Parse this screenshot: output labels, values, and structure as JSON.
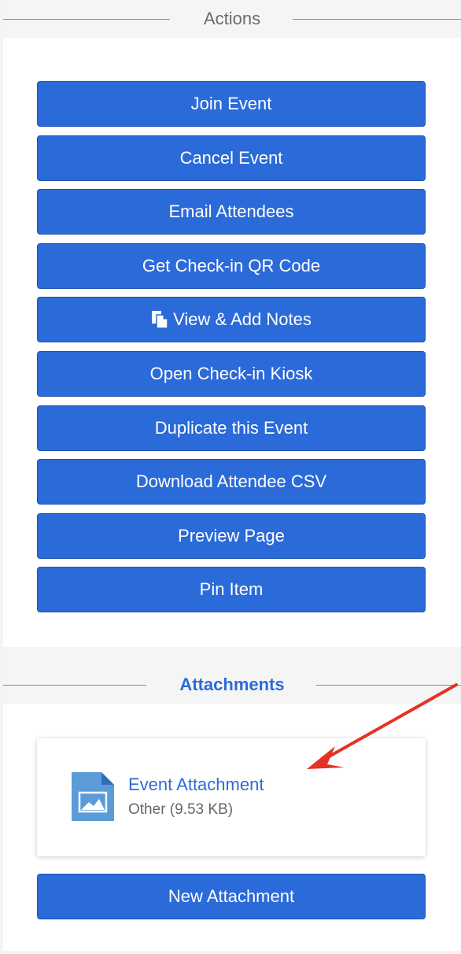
{
  "actions": {
    "title": "Actions",
    "buttons": [
      {
        "label": "Join Event"
      },
      {
        "label": "Cancel Event"
      },
      {
        "label": "Email Attendees"
      },
      {
        "label": "Get Check-in QR Code"
      },
      {
        "label": "View & Add Notes",
        "icon": "notes-icon"
      },
      {
        "label": "Open Check-in Kiosk"
      },
      {
        "label": "Duplicate this Event"
      },
      {
        "label": "Download Attendee CSV"
      },
      {
        "label": "Preview Page"
      },
      {
        "label": "Pin Item"
      }
    ]
  },
  "attachments": {
    "title": "Attachments",
    "items": [
      {
        "name": "Event Attachment",
        "meta": "Other (9.53 KB)",
        "icon": "image-file-icon"
      }
    ],
    "new_button_label": "New Attachment"
  },
  "colors": {
    "button_bg": "#2b6ad9",
    "link": "#2a6bd8",
    "annotation_arrow": "#e53225"
  }
}
